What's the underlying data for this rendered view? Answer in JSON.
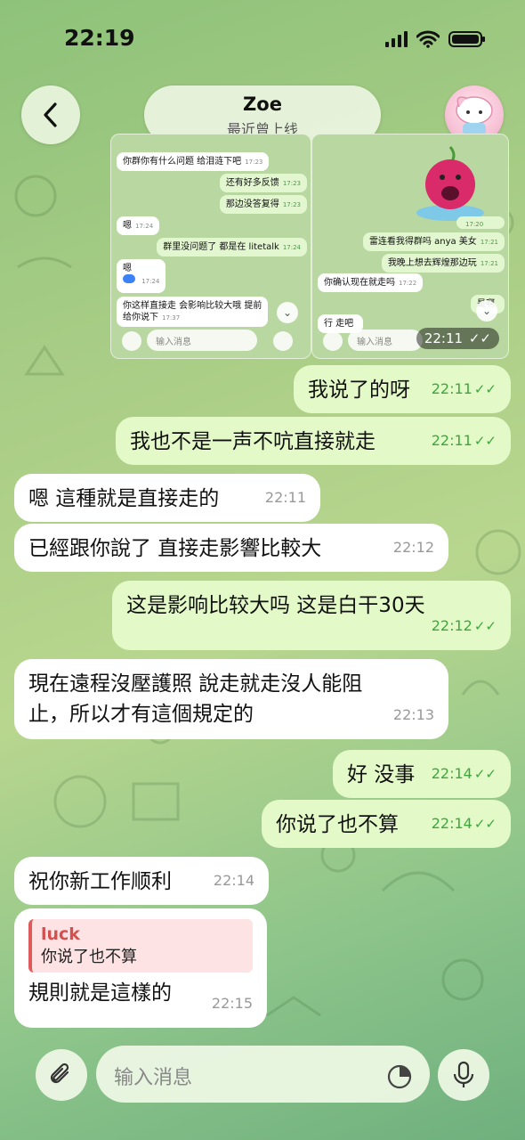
{
  "status_bar": {
    "time": "22:19"
  },
  "header": {
    "back_icon": "chevron-left-icon",
    "name": "Zoe",
    "status": "最近曾上线"
  },
  "shared_screenshots": {
    "left": {
      "messages": [
        {
          "dir": "in",
          "text": "你群你有什么问题 给泪涟下吧",
          "time": "17:23"
        },
        {
          "dir": "out",
          "text": "还有好多反馈",
          "time": "17:23"
        },
        {
          "dir": "out",
          "text": "那边没答复得",
          "time": "17:23"
        },
        {
          "dir": "in",
          "text": "嗯",
          "time": "17:24"
        },
        {
          "dir": "out",
          "text": "群里没问题了 都是在 litetalk",
          "time": "17:24"
        },
        {
          "dir": "in",
          "text": "嗯",
          "time": "17:24"
        },
        {
          "dir": "in",
          "text": "你这样直接走 会影响比较大哦 提前",
          "time": ""
        },
        {
          "dir": "in",
          "text": "给你说下",
          "time": "17:37"
        }
      ],
      "input_placeholder": "输入消息"
    },
    "right": {
      "messages": [
        {
          "dir": "out",
          "text": "",
          "time": "17:20"
        },
        {
          "dir": "out",
          "text": "雷连看我得群吗 anya 美女",
          "time": "17:21"
        },
        {
          "dir": "out",
          "text": "我晚上想去辉煌那边玩",
          "time": "17:21"
        },
        {
          "dir": "in",
          "text": "你确认现在就走吗",
          "time": "17:22"
        },
        {
          "dir": "out",
          "text": "是啊",
          "time": ""
        },
        {
          "dir": "in",
          "text": "行 走吧",
          "time": ""
        }
      ],
      "input_placeholder": "输入消息"
    },
    "time": "22:11"
  },
  "messages": [
    {
      "dir": "out",
      "text": "我说了的呀",
      "time": "22:11"
    },
    {
      "dir": "out",
      "text": "我也不是一声不吭直接就走",
      "time": "22:11"
    },
    {
      "dir": "in",
      "text": "嗯 這種就是直接走的",
      "time": "22:11"
    },
    {
      "dir": "in",
      "text": "已經跟你說了 直接走影響比較大",
      "time": "22:12"
    },
    {
      "dir": "out",
      "text": "这是影响比较大吗 这是白干30天",
      "time": "22:12"
    },
    {
      "dir": "in",
      "text": "現在遠程沒壓護照 說走就走沒人能阻",
      "text2": "止，所以才有這個規定的",
      "time": "22:13"
    },
    {
      "dir": "out",
      "text": "好 没事",
      "time": "22:14"
    },
    {
      "dir": "out",
      "text": "你说了也不算",
      "time": "22:14"
    },
    {
      "dir": "in",
      "text": "祝你新工作顺利",
      "time": "22:14"
    },
    {
      "dir": "in",
      "reply_name": "luck",
      "reply_text": "你说了也不算",
      "text": "規則就是這樣的",
      "time": "22:15"
    }
  ],
  "input": {
    "placeholder": "输入消息"
  },
  "colors": {
    "out_bubble": "#e3f9c8",
    "in_bubble": "#ffffff",
    "check": "#3ea73e"
  }
}
